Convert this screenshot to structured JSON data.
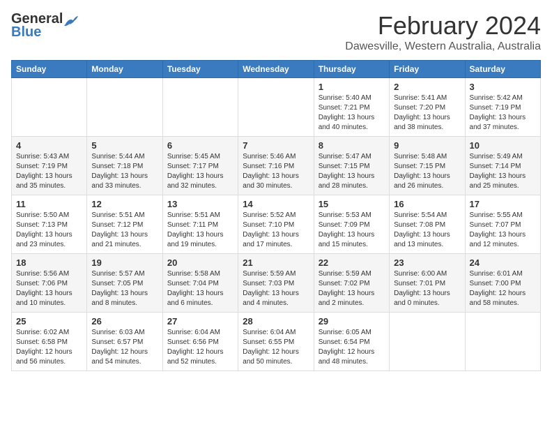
{
  "logo": {
    "general": "General",
    "blue": "Blue"
  },
  "header": {
    "month": "February 2024",
    "location": "Dawesville, Western Australia, Australia"
  },
  "weekdays": [
    "Sunday",
    "Monday",
    "Tuesday",
    "Wednesday",
    "Thursday",
    "Friday",
    "Saturday"
  ],
  "weeks": [
    [
      {
        "day": "",
        "info": ""
      },
      {
        "day": "",
        "info": ""
      },
      {
        "day": "",
        "info": ""
      },
      {
        "day": "",
        "info": ""
      },
      {
        "day": "1",
        "info": "Sunrise: 5:40 AM\nSunset: 7:21 PM\nDaylight: 13 hours\nand 40 minutes."
      },
      {
        "day": "2",
        "info": "Sunrise: 5:41 AM\nSunset: 7:20 PM\nDaylight: 13 hours\nand 38 minutes."
      },
      {
        "day": "3",
        "info": "Sunrise: 5:42 AM\nSunset: 7:19 PM\nDaylight: 13 hours\nand 37 minutes."
      }
    ],
    [
      {
        "day": "4",
        "info": "Sunrise: 5:43 AM\nSunset: 7:19 PM\nDaylight: 13 hours\nand 35 minutes."
      },
      {
        "day": "5",
        "info": "Sunrise: 5:44 AM\nSunset: 7:18 PM\nDaylight: 13 hours\nand 33 minutes."
      },
      {
        "day": "6",
        "info": "Sunrise: 5:45 AM\nSunset: 7:17 PM\nDaylight: 13 hours\nand 32 minutes."
      },
      {
        "day": "7",
        "info": "Sunrise: 5:46 AM\nSunset: 7:16 PM\nDaylight: 13 hours\nand 30 minutes."
      },
      {
        "day": "8",
        "info": "Sunrise: 5:47 AM\nSunset: 7:15 PM\nDaylight: 13 hours\nand 28 minutes."
      },
      {
        "day": "9",
        "info": "Sunrise: 5:48 AM\nSunset: 7:15 PM\nDaylight: 13 hours\nand 26 minutes."
      },
      {
        "day": "10",
        "info": "Sunrise: 5:49 AM\nSunset: 7:14 PM\nDaylight: 13 hours\nand 25 minutes."
      }
    ],
    [
      {
        "day": "11",
        "info": "Sunrise: 5:50 AM\nSunset: 7:13 PM\nDaylight: 13 hours\nand 23 minutes."
      },
      {
        "day": "12",
        "info": "Sunrise: 5:51 AM\nSunset: 7:12 PM\nDaylight: 13 hours\nand 21 minutes."
      },
      {
        "day": "13",
        "info": "Sunrise: 5:51 AM\nSunset: 7:11 PM\nDaylight: 13 hours\nand 19 minutes."
      },
      {
        "day": "14",
        "info": "Sunrise: 5:52 AM\nSunset: 7:10 PM\nDaylight: 13 hours\nand 17 minutes."
      },
      {
        "day": "15",
        "info": "Sunrise: 5:53 AM\nSunset: 7:09 PM\nDaylight: 13 hours\nand 15 minutes."
      },
      {
        "day": "16",
        "info": "Sunrise: 5:54 AM\nSunset: 7:08 PM\nDaylight: 13 hours\nand 13 minutes."
      },
      {
        "day": "17",
        "info": "Sunrise: 5:55 AM\nSunset: 7:07 PM\nDaylight: 13 hours\nand 12 minutes."
      }
    ],
    [
      {
        "day": "18",
        "info": "Sunrise: 5:56 AM\nSunset: 7:06 PM\nDaylight: 13 hours\nand 10 minutes."
      },
      {
        "day": "19",
        "info": "Sunrise: 5:57 AM\nSunset: 7:05 PM\nDaylight: 13 hours\nand 8 minutes."
      },
      {
        "day": "20",
        "info": "Sunrise: 5:58 AM\nSunset: 7:04 PM\nDaylight: 13 hours\nand 6 minutes."
      },
      {
        "day": "21",
        "info": "Sunrise: 5:59 AM\nSunset: 7:03 PM\nDaylight: 13 hours\nand 4 minutes."
      },
      {
        "day": "22",
        "info": "Sunrise: 5:59 AM\nSunset: 7:02 PM\nDaylight: 13 hours\nand 2 minutes."
      },
      {
        "day": "23",
        "info": "Sunrise: 6:00 AM\nSunset: 7:01 PM\nDaylight: 13 hours\nand 0 minutes."
      },
      {
        "day": "24",
        "info": "Sunrise: 6:01 AM\nSunset: 7:00 PM\nDaylight: 12 hours\nand 58 minutes."
      }
    ],
    [
      {
        "day": "25",
        "info": "Sunrise: 6:02 AM\nSunset: 6:58 PM\nDaylight: 12 hours\nand 56 minutes."
      },
      {
        "day": "26",
        "info": "Sunrise: 6:03 AM\nSunset: 6:57 PM\nDaylight: 12 hours\nand 54 minutes."
      },
      {
        "day": "27",
        "info": "Sunrise: 6:04 AM\nSunset: 6:56 PM\nDaylight: 12 hours\nand 52 minutes."
      },
      {
        "day": "28",
        "info": "Sunrise: 6:04 AM\nSunset: 6:55 PM\nDaylight: 12 hours\nand 50 minutes."
      },
      {
        "day": "29",
        "info": "Sunrise: 6:05 AM\nSunset: 6:54 PM\nDaylight: 12 hours\nand 48 minutes."
      },
      {
        "day": "",
        "info": ""
      },
      {
        "day": "",
        "info": ""
      }
    ]
  ]
}
